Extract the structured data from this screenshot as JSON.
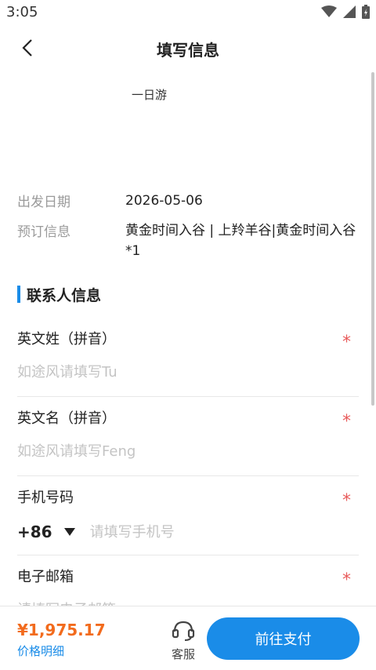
{
  "status": {
    "time": "3:05"
  },
  "header": {
    "title": "填写信息"
  },
  "product": {
    "name": "一日游"
  },
  "booking": {
    "date_label": "出发日期",
    "date_value": "2026-05-06",
    "info_label": "预订信息",
    "info_value": "黄金时间入谷 | 上羚羊谷|黄金时间入谷*1"
  },
  "contact": {
    "section_title": "联系人信息",
    "last_name_label": "英文姓（拼音）",
    "last_name_placeholder": "如途风请填写Tu",
    "first_name_label": "英文名（拼音）",
    "first_name_placeholder": "如途风请填写Feng",
    "phone_label": "手机号码",
    "country_code": "+86",
    "phone_placeholder": "请填写手机号",
    "email_label": "电子邮箱",
    "email_placeholder": "请填写电子邮箱",
    "required_mark": "*"
  },
  "footer": {
    "price": "¥1,975.17",
    "price_detail": "价格明细",
    "service_label": "客服",
    "pay_label": "前往支付"
  },
  "colors": {
    "accent": "#1a8ce8",
    "price": "#f26b1d",
    "required": "#e85a5a"
  }
}
